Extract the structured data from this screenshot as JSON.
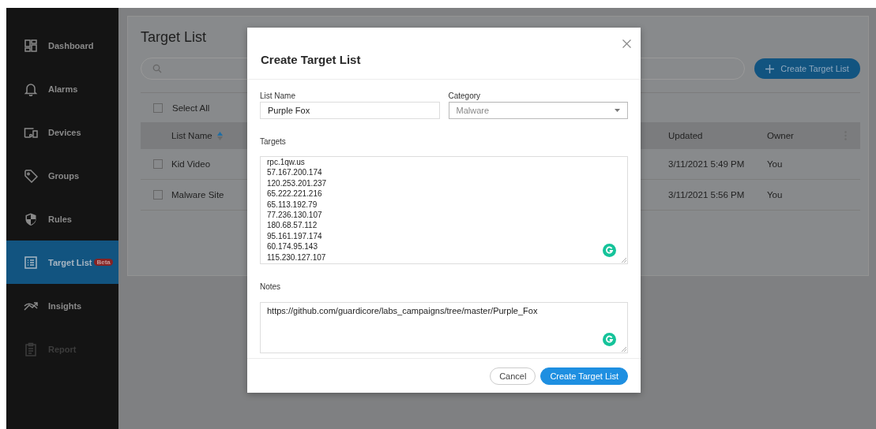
{
  "sidebar": {
    "items": [
      {
        "label": "Dashboard",
        "selected": false,
        "disabled": false
      },
      {
        "label": "Alarms",
        "selected": false,
        "disabled": false
      },
      {
        "label": "Devices",
        "selected": false,
        "disabled": false
      },
      {
        "label": "Groups",
        "selected": false,
        "disabled": false
      },
      {
        "label": "Rules",
        "selected": false,
        "disabled": false
      },
      {
        "label": "Target List",
        "selected": true,
        "disabled": false,
        "badge": "Beta"
      },
      {
        "label": "Insights",
        "selected": false,
        "disabled": false
      },
      {
        "label": "Report",
        "selected": false,
        "disabled": true
      }
    ]
  },
  "page": {
    "title": "Target List",
    "create_button": "Create Target List",
    "select_all": {
      "label": "Select All",
      "checked": false
    },
    "table": {
      "columns": [
        {
          "label": "List Name",
          "sorted": true
        },
        {
          "label": "Updated",
          "sorted": false
        },
        {
          "label": "Owner",
          "sorted": false
        }
      ],
      "rows": [
        {
          "checked": false,
          "cells": [
            "Kid Video",
            "3/11/2021 5:49 PM",
            "You"
          ]
        },
        {
          "checked": false,
          "cells": [
            "Malware Site",
            "3/11/2021 5:56 PM",
            "You"
          ]
        }
      ]
    }
  },
  "modal": {
    "title": "Create Target List",
    "list_name": {
      "label": "List Name",
      "value": "Purple Fox"
    },
    "category": {
      "label": "Category",
      "value": "Malware"
    },
    "targets": {
      "label": "Targets",
      "lines": [
        "rpc.1qw.us",
        "57.167.200.174",
        "120.253.201.237",
        "65.222.221.216",
        "65.113.192.79",
        "77.236.130.107",
        "180.68.57.112",
        "95.161.197.174",
        "60.174.95.143",
        "115.230.127.107"
      ]
    },
    "notes": {
      "label": "Notes",
      "value": "https://github.com/guardicore/labs_campaigns/tree/master/Purple_Fox"
    },
    "buttons": [
      {
        "label": "Cancel",
        "kind": "secondary"
      },
      {
        "label": "Create Target List",
        "kind": "primary"
      }
    ]
  }
}
